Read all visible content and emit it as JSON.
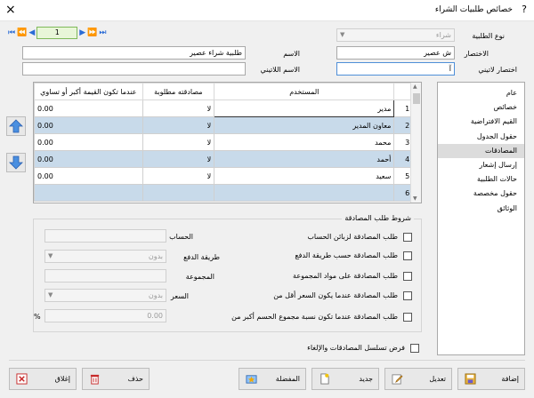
{
  "window": {
    "title": "خصائص طلبيات الشراء",
    "help": "?",
    "close": "×"
  },
  "nav": {
    "first": "⏮",
    "prev2": "⏪",
    "prev": "◀",
    "current": "1",
    "next": "▶",
    "next2": "⏩",
    "last": "⏭"
  },
  "form": {
    "order_type_label": "نوع الطلبية",
    "order_type_value": "شراء",
    "short_label": "الاختصار",
    "short_value": "ش عصير",
    "short_latin_label": "اختصار لاتيني",
    "short_latin_value": "آ",
    "name_label": "الاسم",
    "name_value": "طلبية شراء عصير",
    "latin_name_label": "الاسم اللاتيني",
    "latin_name_value": ""
  },
  "grid": {
    "headers": {
      "user": "المستخدم",
      "approval": "مصادقته مطلوبة",
      "threshold": "عندما تكون القيمة أكبر أو تساوي"
    },
    "rows": [
      {
        "n": "1",
        "user": "مدير",
        "approval": "لا",
        "threshold": "0.00"
      },
      {
        "n": "2",
        "user": "معاون المدير",
        "approval": "لا",
        "threshold": "0.00"
      },
      {
        "n": "3",
        "user": "محمد",
        "approval": "لا",
        "threshold": "0.00"
      },
      {
        "n": "4",
        "user": "أحمد",
        "approval": "لا",
        "threshold": "0.00"
      },
      {
        "n": "5",
        "user": "سعيد",
        "approval": "لا",
        "threshold": "0.00"
      },
      {
        "n": "6",
        "user": "",
        "approval": "",
        "threshold": ""
      }
    ]
  },
  "sidebar": {
    "items": [
      {
        "label": "عام"
      },
      {
        "label": "خصائص"
      },
      {
        "label": "القيم الافتراضية"
      },
      {
        "label": "حقول الجدول"
      },
      {
        "label": "المصادقات"
      },
      {
        "label": "إرسال إشعار"
      },
      {
        "label": "حالات الطلبية"
      },
      {
        "label": "حقول مخصصة"
      },
      {
        "label": "الوثائق"
      }
    ]
  },
  "conditions": {
    "legend": "شروط طلب المصادقة",
    "c1": "طلب المصادقة لزبائن الحساب",
    "c2": "طلب المصادقة حسب طريقة الدفع",
    "c3": "طلب المصادقة على مواد المجموعة",
    "c4": "طلب المصادقة عندما يكون السعر أقل من",
    "c5": "طلب المصادقة عندما تكون نسبة مجموع الحسم أكبر من",
    "account_label": "الحساب",
    "payment_label": "طريقة الدفع",
    "payment_value": "بدون",
    "group_label": "المجموعة",
    "price_label": "السعر",
    "price_value": "بدون",
    "percent_value": "0.00",
    "percent_sign": "%"
  },
  "enforce_label": "فرض تسلسل المصادقات والإلغاء",
  "buttons": {
    "add": "إضافة",
    "edit": "تعديل",
    "new": "جديد",
    "favorite": "المفضلة",
    "delete": "حذف",
    "close": "إغلاق"
  }
}
